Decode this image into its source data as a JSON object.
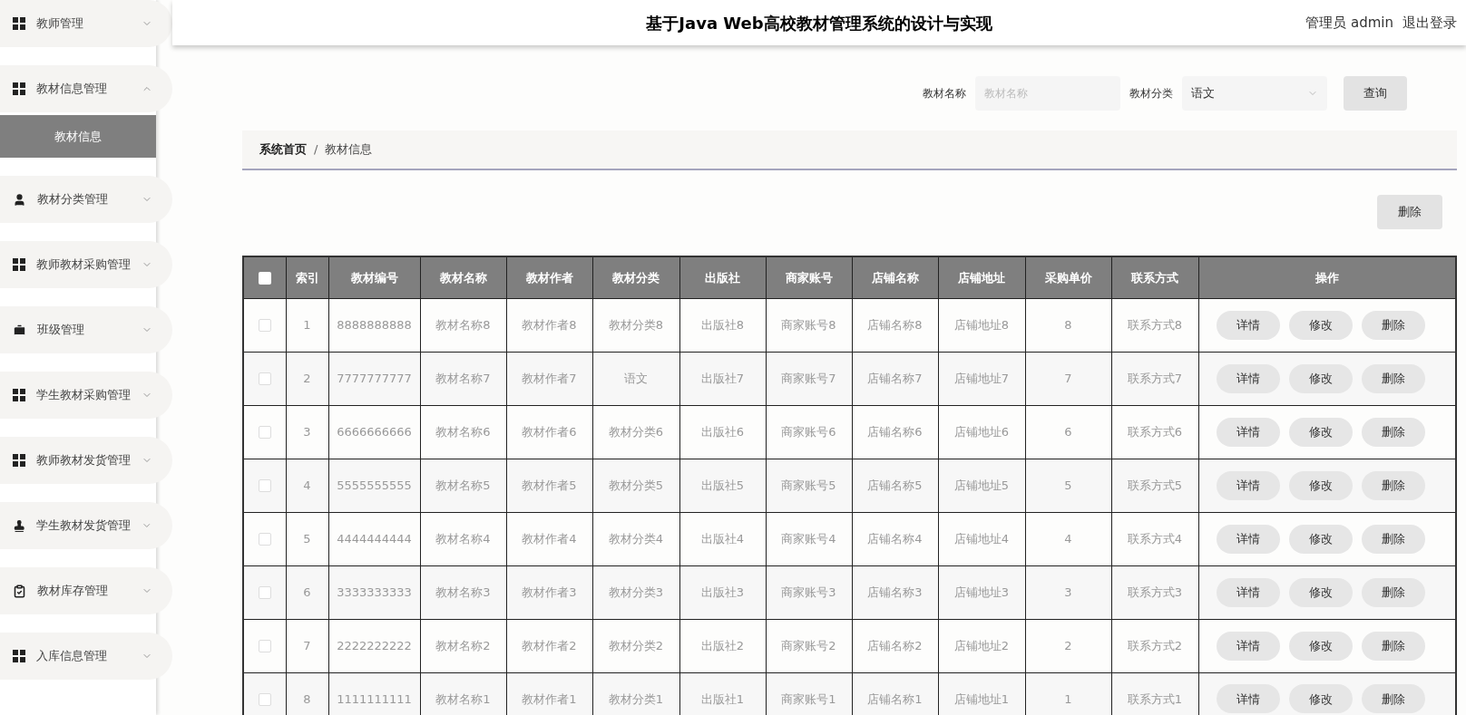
{
  "header": {
    "title": "基于Java Web高校教材管理系统的设计与实现",
    "user": "管理员 admin",
    "logout": "退出登录"
  },
  "sidebar": {
    "items": [
      {
        "label": "教师管理",
        "kind": "grid",
        "expanded": false
      },
      {
        "label": "教材信息管理",
        "kind": "grid",
        "expanded": true,
        "children": [
          {
            "label": "教材信息",
            "selected": true
          }
        ]
      },
      {
        "label": "教材分类管理",
        "kind": "person",
        "expanded": false
      },
      {
        "label": "教师教材采购管理",
        "kind": "grid",
        "expanded": false
      },
      {
        "label": "班级管理",
        "kind": "case",
        "expanded": false
      },
      {
        "label": "学生教材采购管理",
        "kind": "grid",
        "expanded": false
      },
      {
        "label": "教师教材发货管理",
        "kind": "grid",
        "expanded": false
      },
      {
        "label": "学生教材发货管理",
        "kind": "stamp",
        "expanded": false
      },
      {
        "label": "教材库存管理",
        "kind": "checklist",
        "expanded": false
      },
      {
        "label": "入库信息管理",
        "kind": "grid",
        "expanded": false
      }
    ]
  },
  "search": {
    "fields": [
      {
        "kind": "text",
        "label": "教材名称",
        "placeholder": "教材名称"
      },
      {
        "kind": "select",
        "label": "教材分类",
        "value": "语文"
      }
    ],
    "button": "查询"
  },
  "breadcrumb": {
    "items": [
      "系统首页",
      "教材信息"
    ],
    "separator": "/"
  },
  "delete_button": "删除",
  "table": {
    "select_all": {
      "checked": false
    },
    "columns": [
      "索引",
      "教材编号",
      "教材名称",
      "教材作者",
      "教材分类",
      "出版社",
      "商家账号",
      "店铺名称",
      "店铺地址",
      "采购单价",
      "联系方式",
      "操作"
    ],
    "rows": [
      {
        "checked": false,
        "cells": [
          "1",
          "8888888888",
          "教材名称8",
          "教材作者8",
          "教材分类8",
          "出版社8",
          "商家账号8",
          "店铺名称8",
          "店铺地址8",
          "8",
          "联系方式8"
        ],
        "actions": [
          "详情",
          "修改",
          "删除"
        ]
      },
      {
        "checked": false,
        "cells": [
          "2",
          "7777777777",
          "教材名称7",
          "教材作者7",
          "语文",
          "出版社7",
          "商家账号7",
          "店铺名称7",
          "店铺地址7",
          "7",
          "联系方式7"
        ],
        "actions": [
          "详情",
          "修改",
          "删除"
        ]
      },
      {
        "checked": false,
        "cells": [
          "3",
          "6666666666",
          "教材名称6",
          "教材作者6",
          "教材分类6",
          "出版社6",
          "商家账号6",
          "店铺名称6",
          "店铺地址6",
          "6",
          "联系方式6"
        ],
        "actions": [
          "详情",
          "修改",
          "删除"
        ]
      },
      {
        "checked": false,
        "cells": [
          "4",
          "5555555555",
          "教材名称5",
          "教材作者5",
          "教材分类5",
          "出版社5",
          "商家账号5",
          "店铺名称5",
          "店铺地址5",
          "5",
          "联系方式5"
        ],
        "actions": [
          "详情",
          "修改",
          "删除"
        ]
      },
      {
        "checked": false,
        "cells": [
          "5",
          "4444444444",
          "教材名称4",
          "教材作者4",
          "教材分类4",
          "出版社4",
          "商家账号4",
          "店铺名称4",
          "店铺地址4",
          "4",
          "联系方式4"
        ],
        "actions": [
          "详情",
          "修改",
          "删除"
        ]
      },
      {
        "checked": false,
        "cells": [
          "6",
          "3333333333",
          "教材名称3",
          "教材作者3",
          "教材分类3",
          "出版社3",
          "商家账号3",
          "店铺名称3",
          "店铺地址3",
          "3",
          "联系方式3"
        ],
        "actions": [
          "详情",
          "修改",
          "删除"
        ]
      },
      {
        "checked": false,
        "cells": [
          "7",
          "2222222222",
          "教材名称2",
          "教材作者2",
          "教材分类2",
          "出版社2",
          "商家账号2",
          "店铺名称2",
          "店铺地址2",
          "2",
          "联系方式2"
        ],
        "actions": [
          "详情",
          "修改",
          "删除"
        ]
      },
      {
        "checked": false,
        "cells": [
          "8",
          "1111111111",
          "教材名称1",
          "教材作者1",
          "教材分类1",
          "出版社1",
          "商家账号1",
          "店铺名称1",
          "店铺地址1",
          "1",
          "联系方式1"
        ],
        "actions": [
          "详情",
          "修改",
          "删除"
        ]
      }
    ]
  }
}
